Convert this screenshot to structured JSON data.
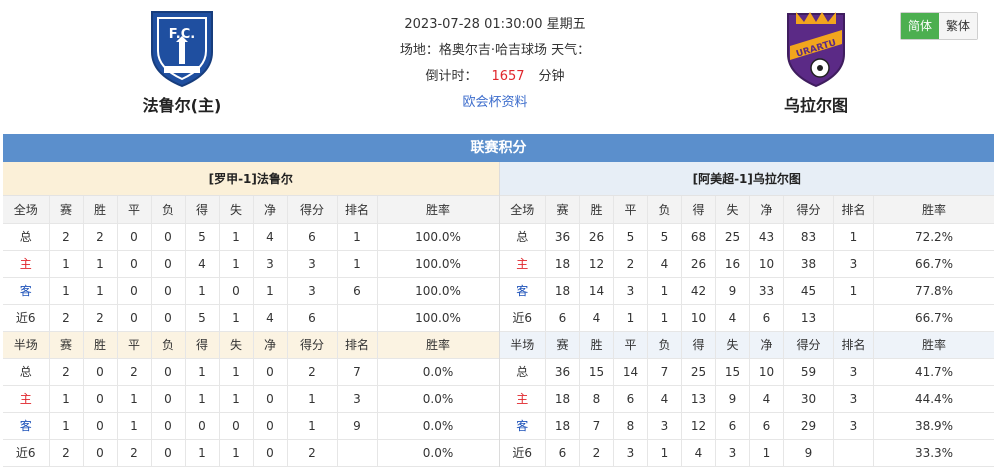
{
  "home": {
    "name": "法鲁尔(主)",
    "logo_icon": "fc-farul-crest-icon",
    "logo_color": "#1f4fa0"
  },
  "away": {
    "name": "乌拉尔图",
    "logo_icon": "urartu-crest-icon",
    "logo_color": "#5b2a86"
  },
  "match": {
    "datetime": "2023-07-28 01:30:00 星期五",
    "venue": "场地：格奥尔吉·哈吉球场 天气：",
    "countdown_label": "倒计时：",
    "countdown_value": "1657",
    "countdown_unit": "分钟",
    "link": "欧会杯资料"
  },
  "lang": {
    "simplified": "简体",
    "traditional": "繁体"
  },
  "section_title": "联赛积分",
  "columns_full": [
    "全场",
    "赛",
    "胜",
    "平",
    "负",
    "得",
    "失",
    "净",
    "得分",
    "排名",
    "胜率"
  ],
  "columns_half": [
    "半场",
    "赛",
    "胜",
    "平",
    "负",
    "得",
    "失",
    "净",
    "得分",
    "排名",
    "胜率"
  ],
  "home_table": {
    "title": "[罗甲-1]法鲁尔",
    "full": [
      [
        "总",
        "2",
        "2",
        "0",
        "0",
        "5",
        "1",
        "4",
        "6",
        "1",
        "100.0%"
      ],
      [
        "主",
        "1",
        "1",
        "0",
        "0",
        "4",
        "1",
        "3",
        "3",
        "1",
        "100.0%"
      ],
      [
        "客",
        "1",
        "1",
        "0",
        "0",
        "1",
        "0",
        "1",
        "3",
        "6",
        "100.0%"
      ],
      [
        "近6",
        "2",
        "2",
        "0",
        "0",
        "5",
        "1",
        "4",
        "6",
        "",
        "100.0%"
      ]
    ],
    "half": [
      [
        "总",
        "2",
        "0",
        "2",
        "0",
        "1",
        "1",
        "0",
        "2",
        "7",
        "0.0%"
      ],
      [
        "主",
        "1",
        "0",
        "1",
        "0",
        "1",
        "1",
        "0",
        "1",
        "3",
        "0.0%"
      ],
      [
        "客",
        "1",
        "0",
        "1",
        "0",
        "0",
        "0",
        "0",
        "1",
        "9",
        "0.0%"
      ],
      [
        "近6",
        "2",
        "0",
        "2",
        "0",
        "1",
        "1",
        "0",
        "2",
        "",
        "0.0%"
      ]
    ]
  },
  "away_table": {
    "title": "[阿美超-1]乌拉尔图",
    "full": [
      [
        "总",
        "36",
        "26",
        "5",
        "5",
        "68",
        "25",
        "43",
        "83",
        "1",
        "72.2%"
      ],
      [
        "主",
        "18",
        "12",
        "2",
        "4",
        "26",
        "16",
        "10",
        "38",
        "3",
        "66.7%"
      ],
      [
        "客",
        "18",
        "14",
        "3",
        "1",
        "42",
        "9",
        "33",
        "45",
        "1",
        "77.8%"
      ],
      [
        "近6",
        "6",
        "4",
        "1",
        "1",
        "10",
        "4",
        "6",
        "13",
        "",
        "66.7%"
      ]
    ],
    "half": [
      [
        "总",
        "36",
        "15",
        "14",
        "7",
        "25",
        "15",
        "10",
        "59",
        "3",
        "41.7%"
      ],
      [
        "主",
        "18",
        "8",
        "6",
        "4",
        "13",
        "9",
        "4",
        "30",
        "3",
        "44.4%"
      ],
      [
        "客",
        "18",
        "7",
        "8",
        "3",
        "12",
        "6",
        "6",
        "29",
        "3",
        "38.9%"
      ],
      [
        "近6",
        "6",
        "2",
        "3",
        "1",
        "4",
        "3",
        "1",
        "9",
        "",
        "33.3%"
      ]
    ]
  }
}
